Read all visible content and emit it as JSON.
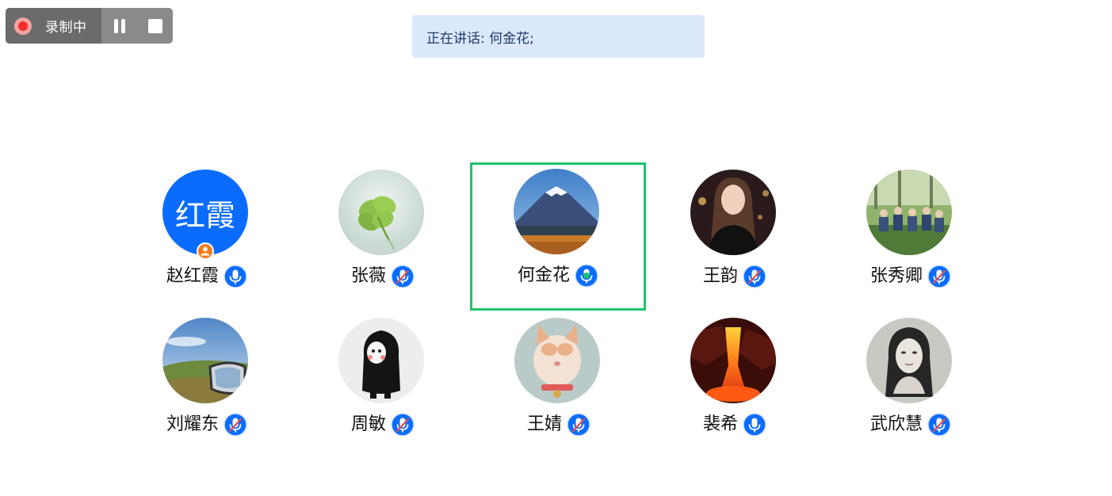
{
  "recording": {
    "status_label": "录制中",
    "pause_icon": "pause-icon",
    "stop_icon": "stop-icon",
    "status_color": "#f02f2f"
  },
  "banner": {
    "text": "正在讲话: 何金花;"
  },
  "colors": {
    "active_border": "#1ec46d",
    "mic_blue": "#0a6cff",
    "mic_muted_slash": "#e84a4a",
    "mic_active": "#19c36a",
    "host_badge": "#f07d1e"
  },
  "participants": [
    {
      "name": "赵红霞",
      "avatar": "initials",
      "initials": "红霞",
      "mic": "on",
      "host": true,
      "speaking": false
    },
    {
      "name": "张薇",
      "avatar": "clover-photo",
      "mic": "muted",
      "host": false,
      "speaking": false
    },
    {
      "name": "何金花",
      "avatar": "mountain-photo",
      "mic": "speaking",
      "host": false,
      "speaking": true
    },
    {
      "name": "王韵",
      "avatar": "portrait-photo",
      "mic": "muted",
      "host": false,
      "speaking": false
    },
    {
      "name": "张秀卿",
      "avatar": "group-photo",
      "mic": "muted",
      "host": false,
      "speaking": false
    },
    {
      "name": "刘耀东",
      "avatar": "car-mirror-photo",
      "mic": "muted",
      "host": false,
      "speaking": false
    },
    {
      "name": "周敏",
      "avatar": "cartoon-photo",
      "mic": "muted",
      "host": false,
      "speaking": false
    },
    {
      "name": "王婧",
      "avatar": "cat-photo",
      "mic": "muted",
      "host": false,
      "speaking": false
    },
    {
      "name": "裴希",
      "avatar": "lava-photo",
      "mic": "on",
      "host": false,
      "speaking": false
    },
    {
      "name": "武欣慧",
      "avatar": "bw-portrait-photo",
      "mic": "muted",
      "host": false,
      "speaking": false
    }
  ]
}
